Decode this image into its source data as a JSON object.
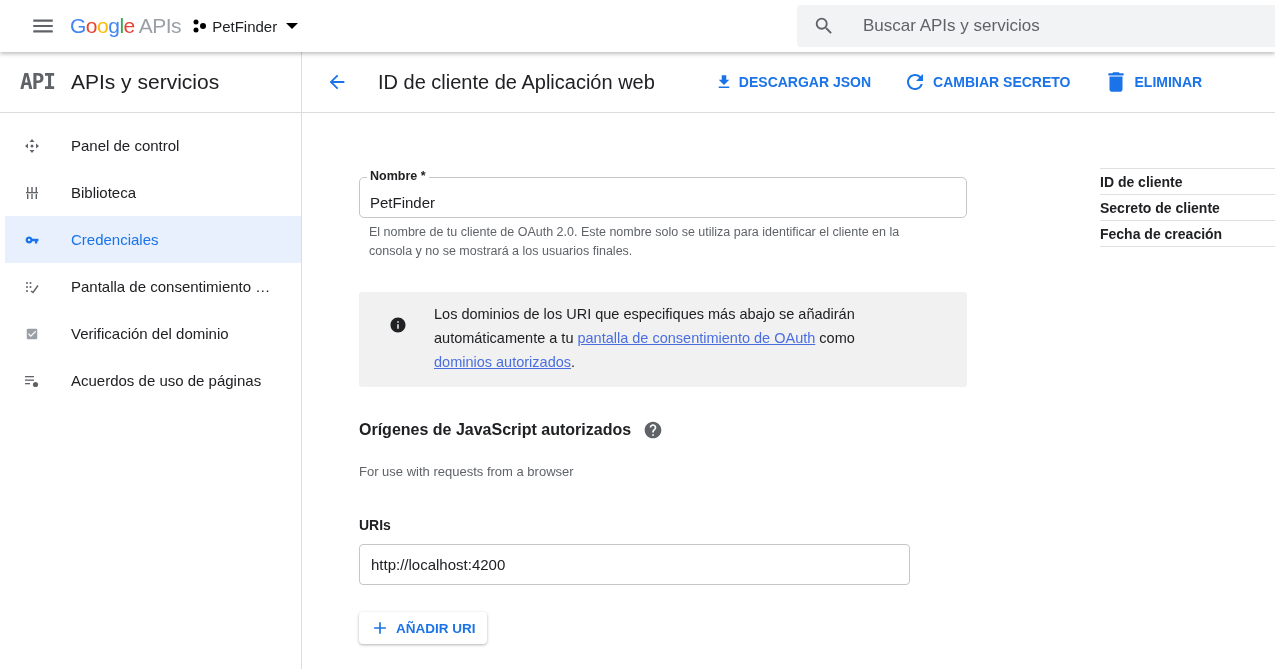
{
  "topbar": {
    "logo": {
      "brand": "Google",
      "product": "APIs"
    },
    "project": "PetFinder",
    "search": {
      "placeholder": "Buscar APIs y servicios"
    }
  },
  "sidebar": {
    "badge": "API",
    "title": "APIs y servicios",
    "items": [
      {
        "label": "Panel de control",
        "selected": false
      },
      {
        "label": "Biblioteca",
        "selected": false
      },
      {
        "label": "Credenciales",
        "selected": true
      },
      {
        "label": "Pantalla de consentimiento …",
        "selected": false
      },
      {
        "label": "Verificación del dominio",
        "selected": false
      },
      {
        "label": "Acuerdos de uso de páginas",
        "selected": false
      }
    ]
  },
  "header": {
    "title": "ID de cliente de Aplicación web",
    "actions": [
      {
        "label": "DESCARGAR JSON"
      },
      {
        "label": "CAMBIAR SECRETO"
      },
      {
        "label": "ELIMINAR"
      }
    ]
  },
  "form": {
    "name_field": {
      "label": "Nombre *",
      "value": "PetFinder",
      "help": "El nombre de tu cliente de OAuth 2.0. Este nombre solo se utiliza para identificar el cliente en la consola y no se mostrará a los usuarios finales."
    },
    "notice": [
      {
        "kind": "text",
        "text": "Los dominios de los URI que especifiques más abajo se añadirán automáticamente a tu "
      },
      {
        "kind": "link",
        "text": "pantalla de consentimiento de OAuth"
      },
      {
        "kind": "text",
        "text": " como "
      },
      {
        "kind": "link",
        "text": "dominios autorizados"
      },
      {
        "kind": "text",
        "text": "."
      }
    ],
    "origins": {
      "title": "Orígenes de JavaScript autorizados",
      "subtitle": "For use with requests from a browser",
      "uris_label": "URIs",
      "uris": [
        "http://localhost:4200"
      ],
      "add_button": "AÑADIR URI"
    }
  },
  "details": {
    "rows": [
      "ID de cliente",
      "Secreto de cliente",
      "Fecha de creación"
    ]
  }
}
